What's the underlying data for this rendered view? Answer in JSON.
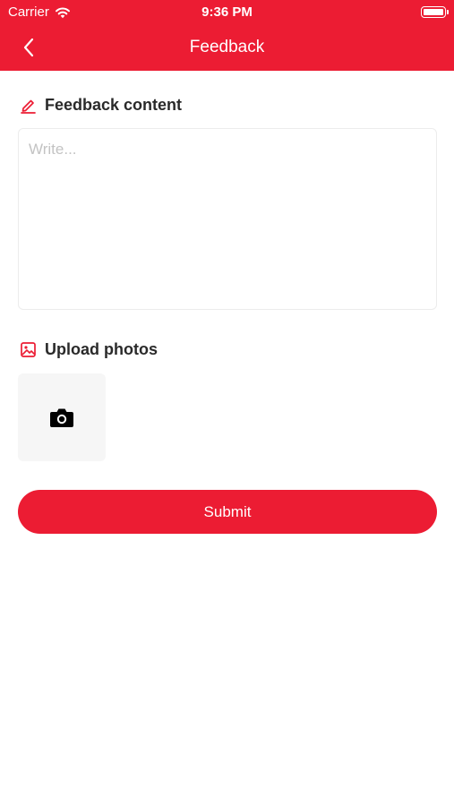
{
  "status_bar": {
    "carrier": "Carrier",
    "time": "9:36 PM",
    "wifi_icon": "wifi-icon",
    "battery_icon": "battery-full-icon"
  },
  "nav": {
    "title": "Feedback",
    "back_icon": "chevron-left-icon"
  },
  "feedback": {
    "title": "Feedback content",
    "icon": "pencil-edit-icon",
    "placeholder": "Write...",
    "value": ""
  },
  "upload": {
    "title": "Upload photos",
    "icon": "image-icon",
    "add_icon": "camera-icon"
  },
  "submit_label": "Submit",
  "colors": {
    "accent": "#ec1c33",
    "placeholder": "#c3c3c3",
    "photo_tile": "#f6f6f6"
  }
}
